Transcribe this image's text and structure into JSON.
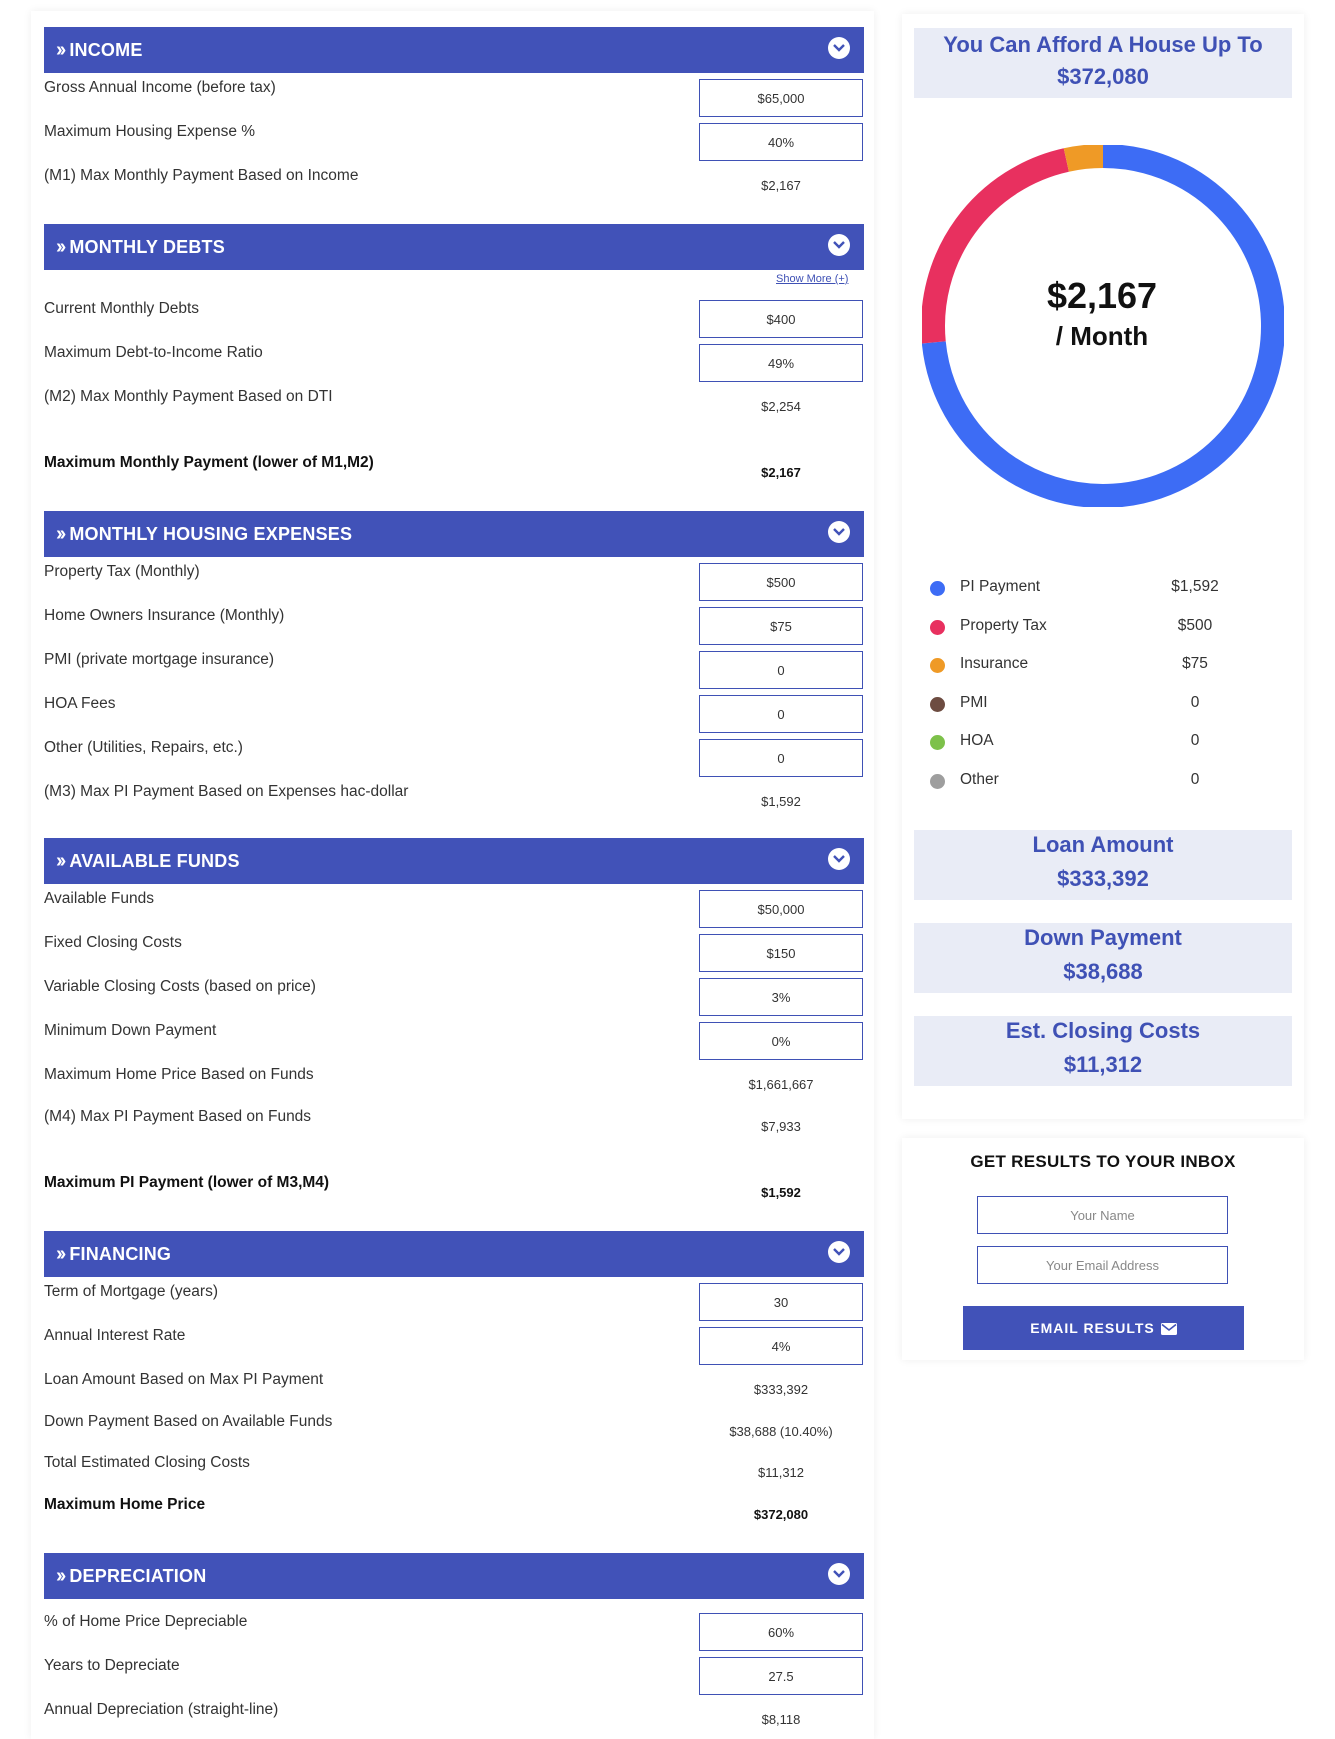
{
  "income": {
    "title": "INCOME",
    "gross_label": "Gross Annual Income (before tax)",
    "gross_value": "$65,000",
    "housing_pct_label": "Maximum Housing Expense %",
    "housing_pct_value": "40%",
    "m1_label": "(M1) Max Monthly Payment Based on Income",
    "m1_value": "$2,167"
  },
  "debts": {
    "title": "MONTHLY DEBTS",
    "show_more": "Show More (+)",
    "current_label": "Current Monthly Debts",
    "current_value": "$400",
    "dti_label": "Maximum Debt-to-Income Ratio",
    "dti_value": "49%",
    "m2_label": "(M2) Max Monthly Payment Based on DTI",
    "m2_value": "$2,254",
    "max_label": "Maximum Monthly Payment (lower of M1,M2)",
    "max_value": "$2,167"
  },
  "housing": {
    "title": "MONTHLY HOUSING EXPENSES",
    "tax_label": "Property Tax (Monthly)",
    "tax_value": "$500",
    "insurance_label": "Home Owners Insurance (Monthly)",
    "insurance_value": "$75",
    "pmi_label": "PMI (private mortgage insurance)",
    "pmi_value": "0",
    "hoa_label": "HOA Fees",
    "hoa_value": "0",
    "other_label": "Other (Utilities, Repairs, etc.)",
    "other_value": "0",
    "m3_label": "(M3) Max PI Payment Based on Expenses hac-dollar",
    "m3_value": "$1,592"
  },
  "funds": {
    "title": "AVAILABLE FUNDS",
    "available_label": "Available Funds",
    "available_value": "$50,000",
    "fixed_label": "Fixed Closing Costs",
    "fixed_value": "$150",
    "variable_label": "Variable Closing Costs (based on price)",
    "variable_value": "3%",
    "min_down_label": "Minimum Down Payment",
    "min_down_value": "0%",
    "max_price_label": "Maximum Home Price Based on Funds",
    "max_price_value": "$1,661,667",
    "m4_label": "(M4) Max PI Payment Based on Funds",
    "m4_value": "$7,933",
    "max_pi_label": "Maximum PI Payment (lower of M3,M4)",
    "max_pi_value": "$1,592"
  },
  "financing": {
    "title": "FINANCING",
    "term_label": "Term of Mortgage (years)",
    "term_value": "30",
    "rate_label": "Annual Interest Rate",
    "rate_value": "4%",
    "loan_label": "Loan Amount Based on Max PI Payment",
    "loan_value": "$333,392",
    "down_label": "Down Payment Based on Available Funds",
    "down_value": "$38,688 (10.40%)",
    "closing_label": "Total Estimated Closing Costs",
    "closing_value": "$11,312",
    "max_home_label": "Maximum Home Price",
    "max_home_value": "$372,080"
  },
  "depreciation": {
    "title": "DEPRECIATION",
    "pct_label": "% of Home Price Depreciable",
    "pct_value": "60%",
    "years_label": "Years to Depreciate",
    "years_value": "27.5",
    "annual_label": "Annual Depreciation (straight-line)",
    "annual_value": "$8,118"
  },
  "summary": {
    "afford_label": "You Can Afford A House Up To",
    "afford_value": "$372,080",
    "monthly_amount": "$2,167",
    "monthly_unit": "/ Month",
    "loan_label": "Loan Amount",
    "loan_value": "$333,392",
    "down_label": "Down Payment",
    "down_value": "$38,688",
    "closing_label": "Est. Closing Costs",
    "closing_value": "$11,312"
  },
  "breakdown": [
    {
      "label": "PI Payment",
      "value": "$1,592",
      "amount": 1592,
      "color": "#3d6cf5"
    },
    {
      "label": "Property Tax",
      "value": "$500",
      "amount": 500,
      "color": "#e8305f"
    },
    {
      "label": "Insurance",
      "value": "$75",
      "amount": 75,
      "color": "#ef9a26"
    },
    {
      "label": "PMI",
      "value": "0",
      "amount": 0,
      "color": "#6d4c41"
    },
    {
      "label": "HOA",
      "value": "0",
      "amount": 0,
      "color": "#7dc14a"
    },
    {
      "label": "Other",
      "value": "0",
      "amount": 0,
      "color": "#9e9e9e"
    }
  ],
  "email": {
    "title": "GET RESULTS TO YOUR INBOX",
    "name_placeholder": "Your Name",
    "email_placeholder": "Your Email Address",
    "button_label": "EMAIL RESULTS"
  }
}
